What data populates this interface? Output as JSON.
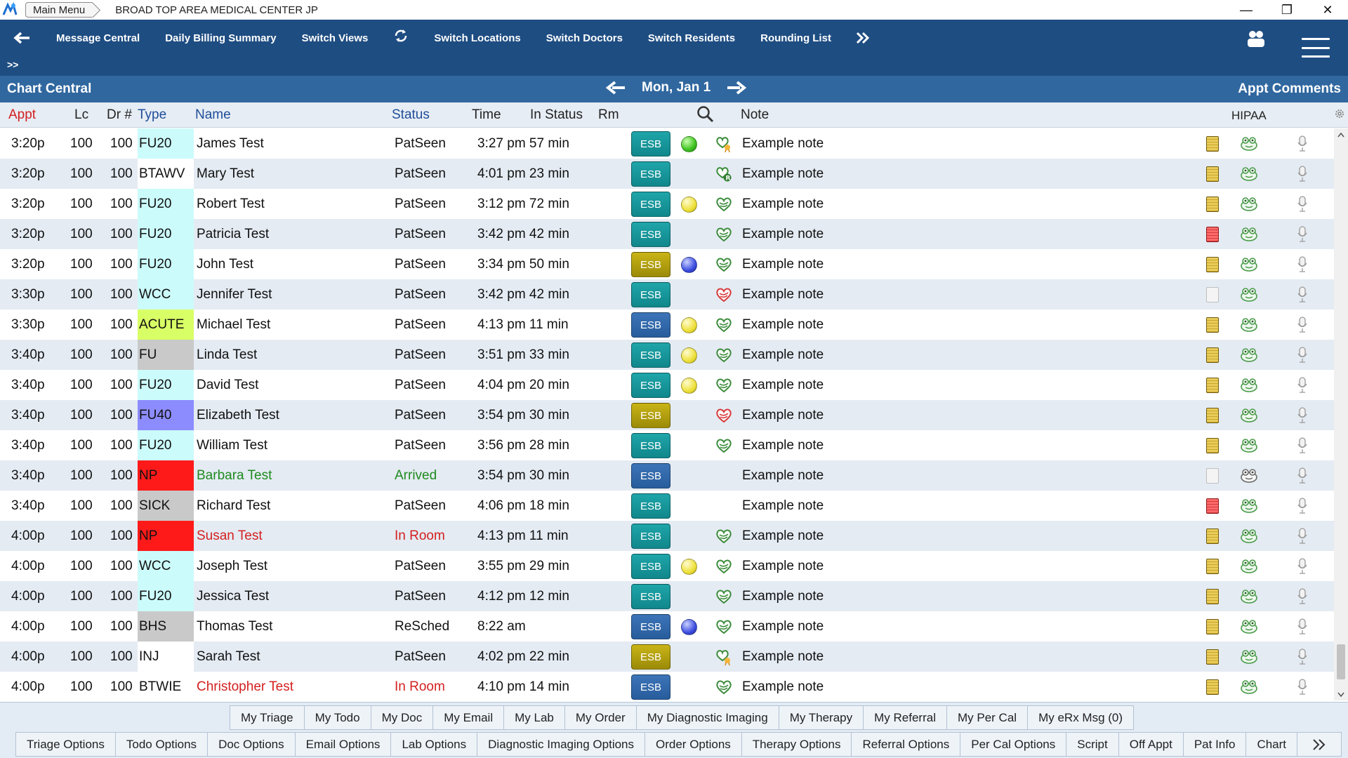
{
  "titlebar": {
    "main_menu": "Main Menu",
    "title": "BROAD TOP AREA MEDICAL CENTER JP",
    "controls": [
      "—",
      "❐",
      "✕"
    ]
  },
  "nav": {
    "items": [
      "Message Central",
      "Daily Billing Summary",
      "Switch Views",
      "Switch Locations",
      "Switch Doctors",
      "Switch Residents",
      "Rounding List"
    ],
    "sub": ">>"
  },
  "central": {
    "title": "Chart Central",
    "date": "Mon, Jan 1",
    "appt_comments": "Appt Comments"
  },
  "columns": {
    "appt": "Appt",
    "lc": "Lc",
    "dr": "Dr #",
    "type": "Type",
    "name": "Name",
    "status": "Status",
    "time": "Time",
    "in_status": "In Status",
    "rm": "Rm",
    "note": "Note",
    "hipaa": "HIPAA"
  },
  "colors": {
    "nav_bg": "#1e4d82",
    "central_bg": "#30679f",
    "row_alt": "#e4ebf3",
    "status_green": "#1f8a1f",
    "status_red": "#d42020"
  },
  "rows": [
    {
      "appt": "3:20p",
      "lc": "100",
      "dr": "100",
      "type": "FU20",
      "type_bg": "#ccfbfb",
      "name": "James Test",
      "status": "PatSeen",
      "time": "3:27 pm 57 min",
      "esb": "ESB",
      "esb_color": "teal",
      "dot": "green",
      "heart": "award",
      "note": "Example note",
      "doc": "yellow"
    },
    {
      "appt": "3:20p",
      "lc": "100",
      "dr": "100",
      "type": "BTAWV",
      "type_bg": "#ffffff",
      "name": "Mary Test",
      "status": "PatSeen",
      "time": "4:01 pm 23 min",
      "esb": "ESB",
      "esb_color": "teal",
      "dot": "",
      "heart": "r-badge",
      "note": "Example note",
      "doc": "yellow"
    },
    {
      "appt": "3:20p",
      "lc": "100",
      "dr": "100",
      "type": "FU20",
      "type_bg": "#ccfbfb",
      "name": "Robert Test",
      "status": "PatSeen",
      "time": "3:12 pm 72 min",
      "esb": "ESB",
      "esb_color": "teal",
      "dot": "yellow",
      "heart": "green",
      "note": "Example note",
      "doc": "yellow"
    },
    {
      "appt": "3:20p",
      "lc": "100",
      "dr": "100",
      "type": "FU20",
      "type_bg": "#ccfbfb",
      "name": "Patricia Test",
      "status": "PatSeen",
      "time": "3:42 pm 42 min",
      "esb": "ESB",
      "esb_color": "teal",
      "dot": "",
      "heart": "green",
      "note": "Example note",
      "doc": "red"
    },
    {
      "appt": "3:20p",
      "lc": "100",
      "dr": "100",
      "type": "FU20",
      "type_bg": "#ccfbfb",
      "name": "John Test",
      "status": "PatSeen",
      "time": "3:34 pm 50 min",
      "esb": "ESB",
      "esb_color": "olive",
      "dot": "blue",
      "heart": "green",
      "note": "Example note",
      "doc": "yellow"
    },
    {
      "appt": "3:30p",
      "lc": "100",
      "dr": "100",
      "type": "WCC",
      "type_bg": "#ccfbfb",
      "name": "Jennifer Test",
      "status": "PatSeen",
      "time": "3:42 pm 42 min",
      "esb": "ESB",
      "esb_color": "teal",
      "dot": "",
      "heart": "red",
      "note": "Example note",
      "doc": "white"
    },
    {
      "appt": "3:30p",
      "lc": "100",
      "dr": "100",
      "type": "ACUTE",
      "type_bg": "#d9ff66",
      "name": "Michael Test",
      "status": "PatSeen",
      "time": "4:13 pm 11 min",
      "esb": "ESB",
      "esb_color": "blue",
      "dot": "yellow",
      "heart": "green",
      "note": "Example note",
      "doc": "yellow"
    },
    {
      "appt": "3:40p",
      "lc": "100",
      "dr": "100",
      "type": "FU",
      "type_bg": "#c9c9c9",
      "name": "Linda Test",
      "status": "PatSeen",
      "time": "3:51 pm 33 min",
      "esb": "ESB",
      "esb_color": "teal",
      "dot": "yellow",
      "heart": "green",
      "note": "Example note",
      "doc": "yellow"
    },
    {
      "appt": "3:40p",
      "lc": "100",
      "dr": "100",
      "type": "FU20",
      "type_bg": "#ccfbfb",
      "name": "David Test",
      "status": "PatSeen",
      "time": "4:04 pm 20 min",
      "esb": "ESB",
      "esb_color": "teal",
      "dot": "yellow",
      "heart": "green",
      "note": "Example note",
      "doc": "yellow"
    },
    {
      "appt": "3:40p",
      "lc": "100",
      "dr": "100",
      "type": "FU40",
      "type_bg": "#8c8cff",
      "name": "Elizabeth Test",
      "status": "PatSeen",
      "time": "3:54 pm 30 min",
      "esb": "ESB",
      "esb_color": "olive",
      "dot": "",
      "heart": "red",
      "note": "Example note",
      "doc": "yellow"
    },
    {
      "appt": "3:40p",
      "lc": "100",
      "dr": "100",
      "type": "FU20",
      "type_bg": "#ccfbfb",
      "name": "William Test",
      "status": "PatSeen",
      "time": "3:56 pm 28 min",
      "esb": "ESB",
      "esb_color": "teal",
      "dot": "",
      "heart": "green",
      "note": "Example note",
      "doc": "yellow"
    },
    {
      "appt": "3:40p",
      "lc": "100",
      "dr": "100",
      "type": "NP",
      "type_bg": "#ff1a1a",
      "name": "Barbara Test",
      "name_color": "green",
      "status": "Arrived",
      "status_color": "green",
      "time": "3:54 pm 30 min",
      "esb": "ESB",
      "esb_color": "blue",
      "dot": "",
      "heart": "",
      "note": "Example note",
      "doc": "white"
    },
    {
      "appt": "3:40p",
      "lc": "100",
      "dr": "100",
      "type": "SICK",
      "type_bg": "#c9c9c9",
      "name": "Richard Test",
      "status": "PatSeen",
      "time": "4:06 pm 18 min",
      "esb": "ESB",
      "esb_color": "teal",
      "dot": "",
      "heart": "",
      "note": "Example note",
      "doc": "red"
    },
    {
      "appt": "4:00p",
      "lc": "100",
      "dr": "100",
      "type": "NP",
      "type_bg": "#ff1a1a",
      "name": "Susan Test",
      "name_color": "red",
      "status": "In Room",
      "status_color": "red",
      "time": "4:13 pm 11 min",
      "esb": "ESB",
      "esb_color": "teal",
      "dot": "",
      "heart": "green",
      "note": "Example note",
      "doc": "yellow"
    },
    {
      "appt": "4:00p",
      "lc": "100",
      "dr": "100",
      "type": "WCC",
      "type_bg": "#ccfbfb",
      "name": "Joseph Test",
      "status": "PatSeen",
      "time": "3:55 pm 29 min",
      "esb": "ESB",
      "esb_color": "teal",
      "dot": "yellow",
      "heart": "green",
      "note": "Example note",
      "doc": "yellow"
    },
    {
      "appt": "4:00p",
      "lc": "100",
      "dr": "100",
      "type": "FU20",
      "type_bg": "#ccfbfb",
      "name": "Jessica Test",
      "status": "PatSeen",
      "time": "4:12 pm 12 min",
      "esb": "ESB",
      "esb_color": "teal",
      "dot": "",
      "heart": "green",
      "note": "Example note",
      "doc": "yellow"
    },
    {
      "appt": "4:00p",
      "lc": "100",
      "dr": "100",
      "type": "BHS",
      "type_bg": "#c9c9c9",
      "name": "Thomas Test",
      "status": "ReSched",
      "time": "8:22 am",
      "esb": "ESB",
      "esb_color": "blue",
      "dot": "blue",
      "heart": "green",
      "note": "Example note",
      "doc": "yellow"
    },
    {
      "appt": "4:00p",
      "lc": "100",
      "dr": "100",
      "type": "INJ",
      "type_bg": "#ffffff",
      "name": "Sarah Test",
      "status": "PatSeen",
      "time": "4:02 pm 22 min",
      "esb": "ESB",
      "esb_color": "olive",
      "dot": "",
      "heart": "award",
      "note": "Example note",
      "doc": "yellow"
    },
    {
      "appt": "4:00p",
      "lc": "100",
      "dr": "100",
      "type": "BTWIE",
      "type_bg": "#ffffff",
      "name": "Christopher Test",
      "name_color": "red",
      "status": "In Room",
      "status_color": "red",
      "time": "4:10 pm 14 min",
      "esb": "ESB",
      "esb_color": "blue",
      "dot": "",
      "heart": "green",
      "note": "Example note",
      "doc": "yellow"
    }
  ],
  "toolbar1": [
    "My Triage",
    "My Todo",
    "My Doc",
    "My Email",
    "My Lab",
    "My Order",
    "My Diagnostic Imaging",
    "My Therapy",
    "My Referral",
    "My Per Cal",
    "My eRx Msg (0)"
  ],
  "toolbar2": [
    "Triage Options",
    "Todo Options",
    "Doc Options",
    "Email Options",
    "Lab Options",
    "Diagnostic Imaging Options",
    "Order Options",
    "Therapy Options",
    "Referral Options",
    "Per Cal Options",
    "Script",
    "Off Appt",
    "Pat Info",
    "Chart"
  ]
}
